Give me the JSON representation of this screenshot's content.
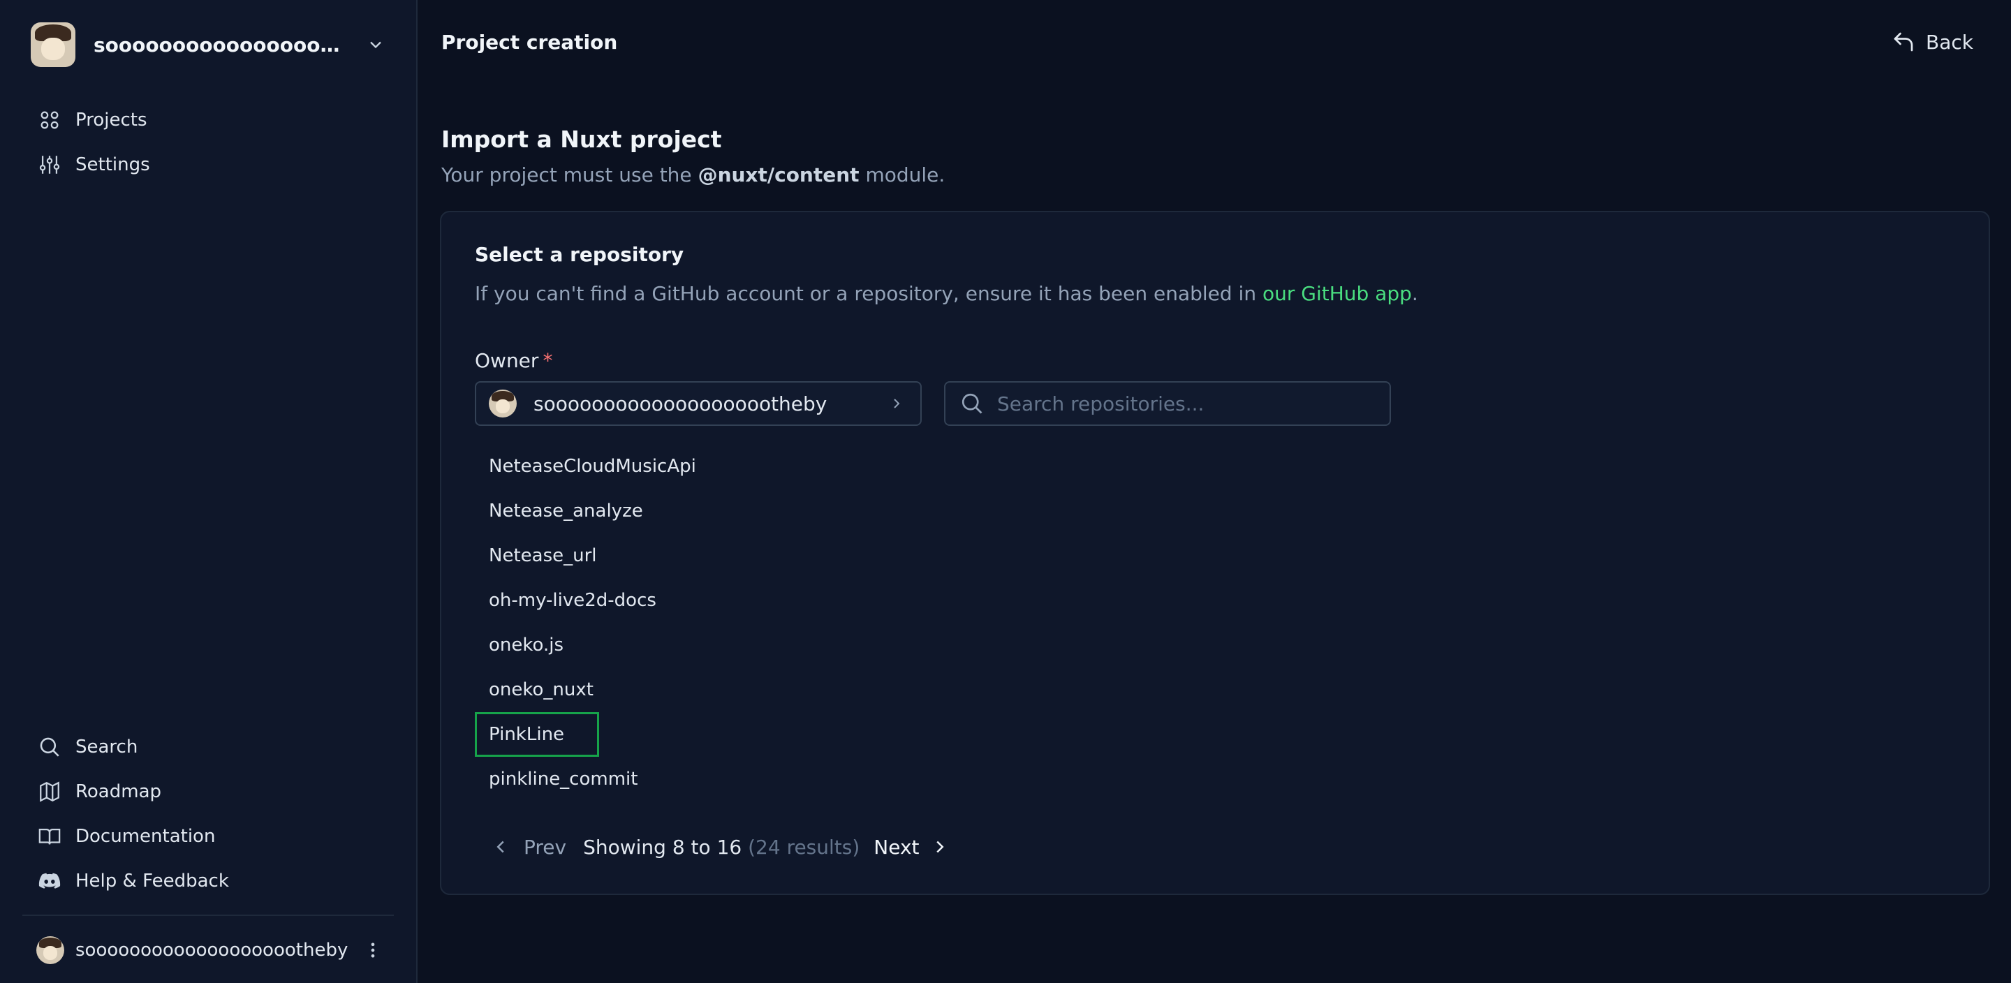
{
  "sidebar": {
    "team_name": "soooooooooooooooooootheby",
    "nav": [
      {
        "label": "Projects",
        "icon": "grid-icon"
      },
      {
        "label": "Settings",
        "icon": "sliders-icon"
      }
    ],
    "bottom_nav": [
      {
        "label": "Search",
        "icon": "search-icon"
      },
      {
        "label": "Roadmap",
        "icon": "map-icon"
      },
      {
        "label": "Documentation",
        "icon": "book-icon"
      },
      {
        "label": "Help & Feedback",
        "icon": "discord-icon"
      }
    ],
    "user_name": "soooooooooooooooooootheby"
  },
  "header": {
    "title": "Project creation",
    "back_label": "Back"
  },
  "import": {
    "title": "Import a Nuxt project",
    "desc_prefix": "Your project must use the ",
    "desc_module": "@nuxt/content",
    "desc_suffix": " module."
  },
  "repo_card": {
    "title": "Select a repository",
    "desc_prefix": "If you can't find a GitHub account or a repository, ensure it has been enabled in ",
    "desc_link": "our GitHub app",
    "desc_suffix": ".",
    "owner_label": "Owner",
    "owner_required": "*",
    "owner_value": "soooooooooooooooooootheby",
    "search_placeholder": "Search repositories...",
    "repos": [
      "NeteaseCloudMusicApi",
      "Netease_analyze",
      "Netease_url",
      "oh-my-live2d-docs",
      "oneko.js",
      "oneko_nuxt",
      "PinkLine",
      "pinkline_commit"
    ],
    "pagination": {
      "prev_label": "Prev",
      "status": "Showing 8 to 16",
      "results": "(24 results)",
      "next_label": "Next"
    }
  },
  "colors": {
    "accent_link": "#4ade80",
    "highlight_border": "#16a34a",
    "required": "#f87171"
  }
}
